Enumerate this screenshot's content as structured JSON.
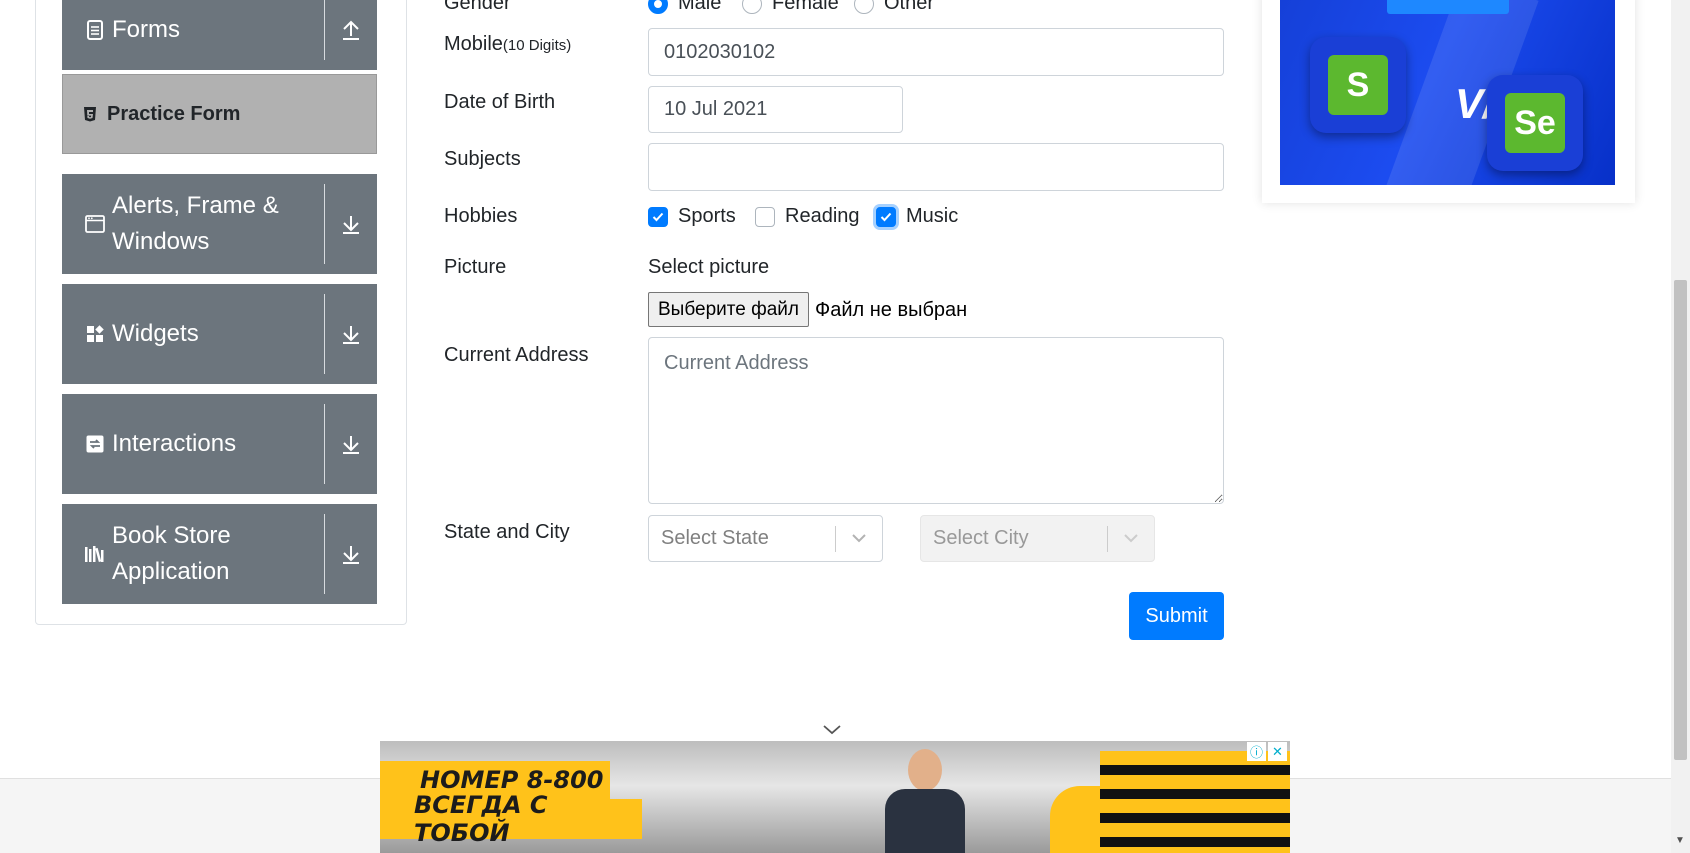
{
  "sidebar": {
    "forms": {
      "label": "Forms",
      "icon": "document-icon",
      "arrow": "arrow-up-icon"
    },
    "practice_form": {
      "label": "Practice Form",
      "icon": "html5-icon"
    },
    "alerts": {
      "label_line1": "Alerts, Frame &",
      "label_line2": "Windows",
      "icon": "window-icon"
    },
    "widgets": {
      "label": "Widgets",
      "icon": "widgets-icon"
    },
    "interactions": {
      "label": "Interactions",
      "icon": "interactions-icon"
    },
    "bookstore": {
      "label_line1": "Book Store",
      "label_line2": "Application",
      "icon": "books-icon"
    }
  },
  "form": {
    "gender": {
      "label": "Gender",
      "options": [
        "Male",
        "Female",
        "Other"
      ],
      "selected": "Male"
    },
    "mobile": {
      "label": "Mobile",
      "hint": "(10 Digits)",
      "value": "0102030102"
    },
    "dob": {
      "label": "Date of Birth",
      "value": "10 Jul 2021"
    },
    "subjects": {
      "label": "Subjects",
      "value": ""
    },
    "hobbies": {
      "label": "Hobbies",
      "options": [
        {
          "label": "Sports",
          "checked": true
        },
        {
          "label": "Reading",
          "checked": false
        },
        {
          "label": "Music",
          "checked": true
        }
      ]
    },
    "picture": {
      "label": "Picture",
      "prompt": "Select picture",
      "button": "Выберите файл",
      "status": "Файл не выбран"
    },
    "address": {
      "label": "Current Address",
      "placeholder": "Current Address"
    },
    "state_city": {
      "label": "State and City",
      "state_placeholder": "Select State",
      "city_placeholder": "Select City"
    },
    "submit": "Submit"
  },
  "bottom_ad": {
    "line1": "НОМЕР 8-800",
    "line2": "ВСЕГДА С ТОБОЙ"
  },
  "colors": {
    "sidebar_bg": "#6c757d",
    "active_item_bg": "#b1b1b1",
    "accent": "#007bff"
  }
}
